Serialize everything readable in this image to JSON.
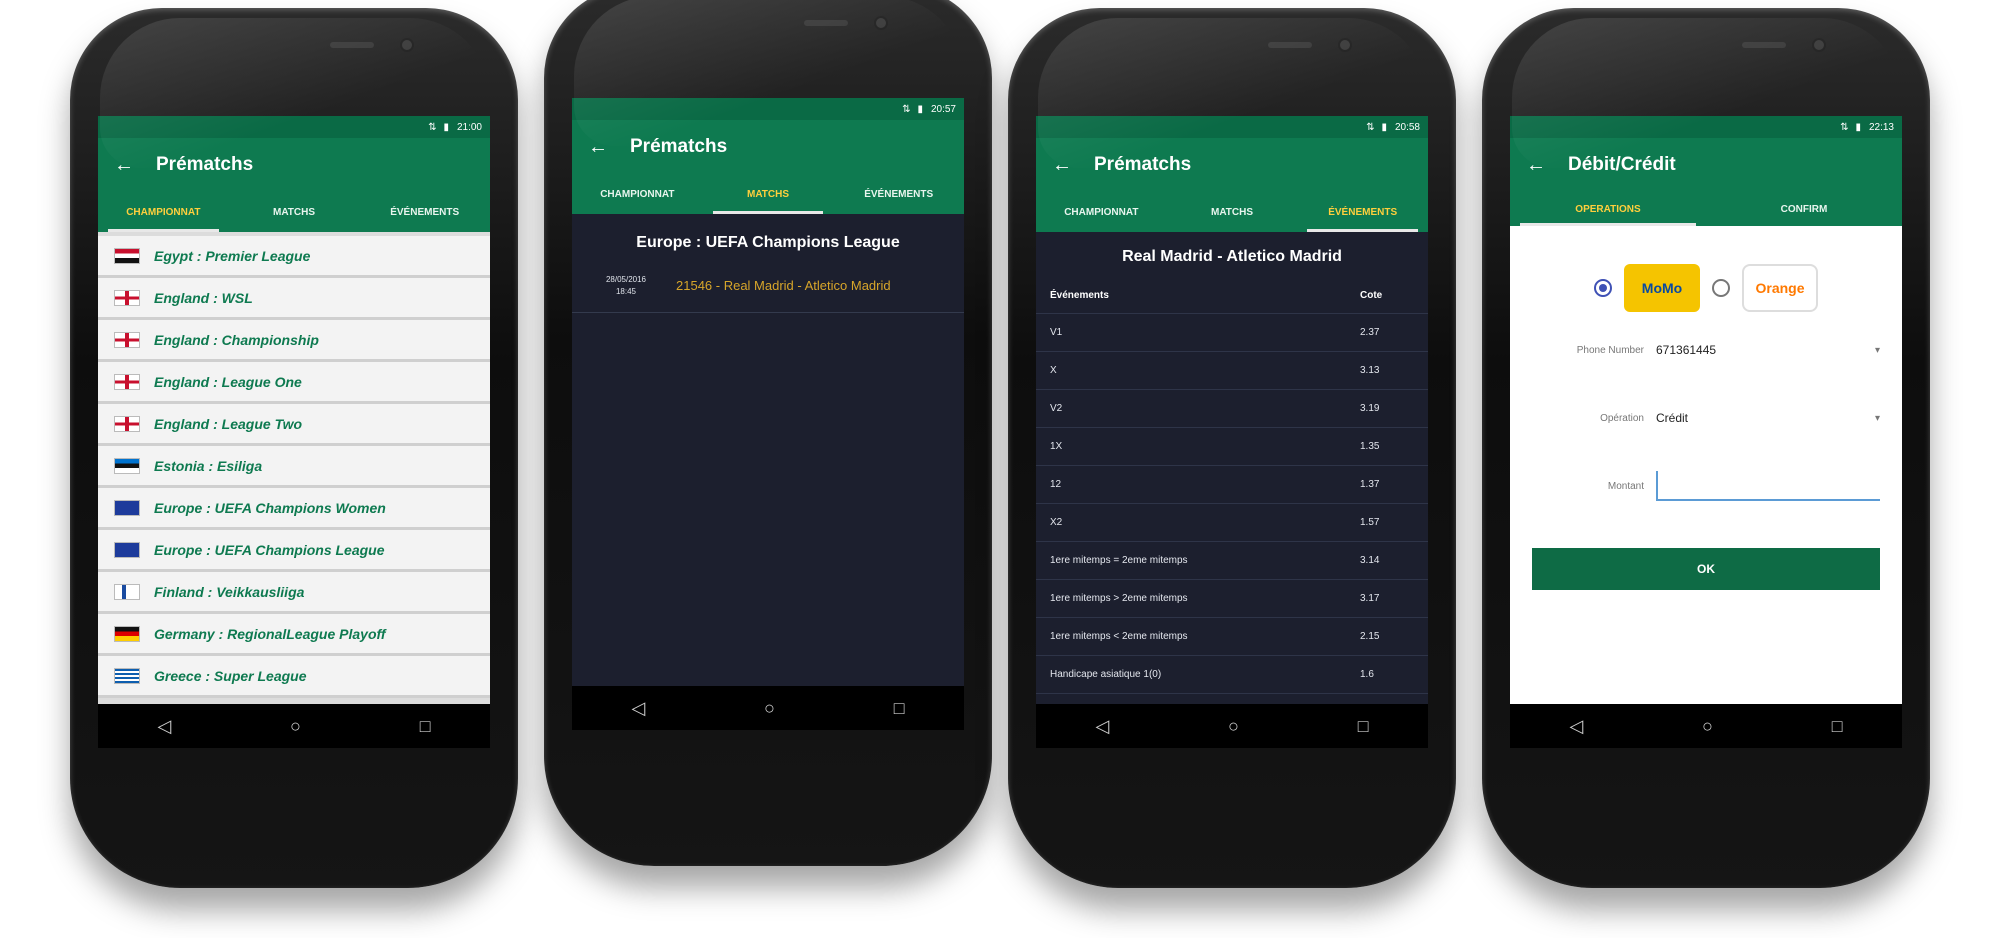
{
  "status": {
    "icons": "⇅ ▮"
  },
  "phone1": {
    "time": "21:00",
    "title": "Prématchs",
    "tabs": [
      "CHAMPIONNAT",
      "MATCHS",
      "ÉVÉNEMENTS"
    ],
    "active_tab": 0,
    "leagues": [
      {
        "name": "Egypt : Premier League",
        "flag": "egypt"
      },
      {
        "name": "England : WSL",
        "flag": "england"
      },
      {
        "name": "England : Championship",
        "flag": "england"
      },
      {
        "name": "England : League One",
        "flag": "england"
      },
      {
        "name": "England : League Two",
        "flag": "england"
      },
      {
        "name": "Estonia : Esiliga",
        "flag": "estonia"
      },
      {
        "name": "Europe : UEFA Champions Women",
        "flag": "eu"
      },
      {
        "name": "Europe : UEFA Champions League",
        "flag": "eu"
      },
      {
        "name": "Finland : Veikkausliiga",
        "flag": "finland"
      },
      {
        "name": "Germany : RegionalLeague Playoff",
        "flag": "germany"
      },
      {
        "name": "Greece : Super League",
        "flag": "greece"
      }
    ]
  },
  "phone2": {
    "time": "20:57",
    "title": "Prématchs",
    "tabs": [
      "CHAMPIONNAT",
      "MATCHS",
      "ÉVÉNEMENTS"
    ],
    "active_tab": 1,
    "competition": "Europe : UEFA Champions League",
    "match_date": "28/05/2016",
    "match_hour": "18:45",
    "match_name": "21546 - Real Madrid - Atletico Madrid"
  },
  "phone3": {
    "time": "20:58",
    "title": "Prématchs",
    "tabs": [
      "CHAMPIONNAT",
      "MATCHS",
      "ÉVÉNEMENTS"
    ],
    "active_tab": 2,
    "event_title": "Real Madrid - Atletico Madrid",
    "col_event": "Événements",
    "col_odds": "Cote",
    "rows": [
      {
        "event": "V1",
        "odd": "2.37"
      },
      {
        "event": "X",
        "odd": "3.13"
      },
      {
        "event": "V2",
        "odd": "3.19"
      },
      {
        "event": "1X",
        "odd": "1.35"
      },
      {
        "event": "12",
        "odd": "1.37"
      },
      {
        "event": "X2",
        "odd": "1.57"
      },
      {
        "event": "1ere mitemps = 2eme mitemps",
        "odd": "3.14"
      },
      {
        "event": "1ere mitemps > 2eme mitemps",
        "odd": "3.17"
      },
      {
        "event": "1ere mitemps < 2eme mitemps",
        "odd": "2.15"
      },
      {
        "event": "Handicape asiatique 1(0)",
        "odd": "1.6"
      }
    ]
  },
  "phone4": {
    "time": "22:13",
    "title": "Débit/Crédit",
    "tabs": [
      "OPERATIONS",
      "CONFIRM"
    ],
    "active_tab": 0,
    "provider_mtn": "MoMo",
    "provider_orange": "Orange",
    "phone_label": "Phone Number",
    "phone_value": "671361445",
    "operation_label": "Opération",
    "operation_value": "Crédit",
    "amount_label": "Montant",
    "amount_value": "",
    "ok_label": "OK"
  },
  "nav_icons": [
    "back-icon",
    "home-icon",
    "recents-icon"
  ]
}
